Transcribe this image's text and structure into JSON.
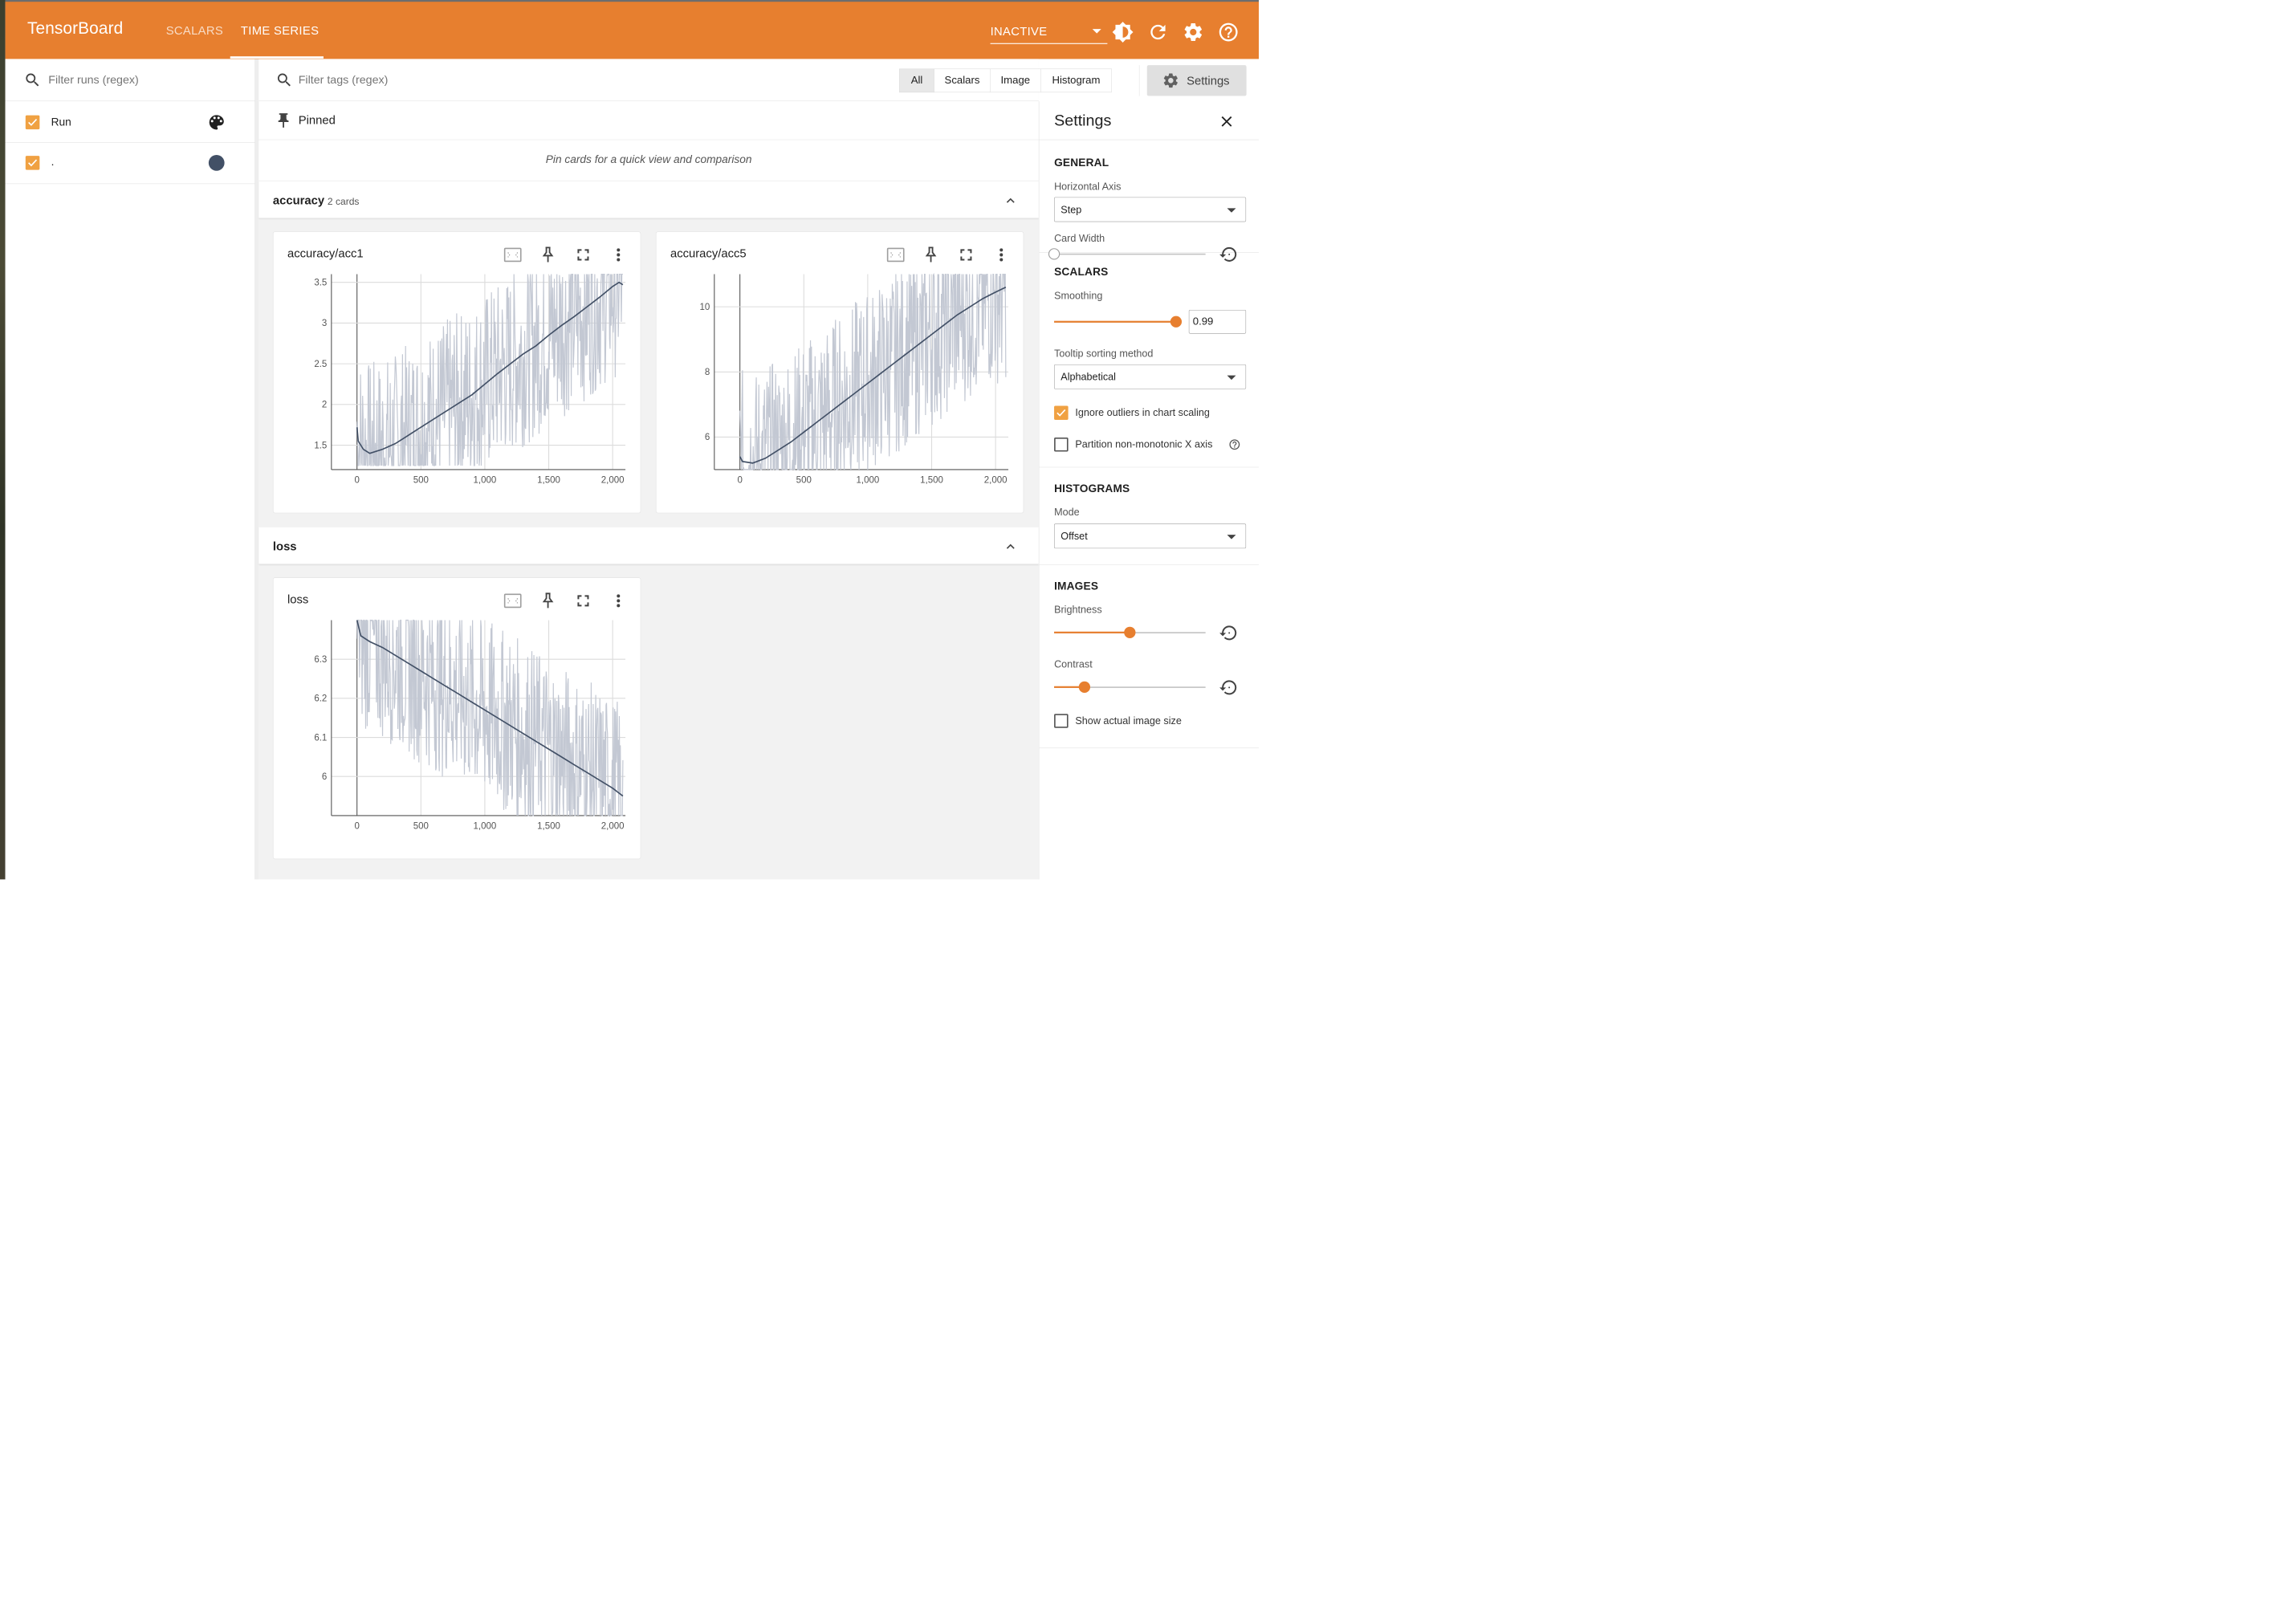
{
  "app": {
    "title": "TensorBoard",
    "nav_tabs": [
      {
        "label": "SCALARS",
        "active": false
      },
      {
        "label": "TIME SERIES",
        "active": true
      }
    ],
    "reload_status": "INACTIVE",
    "icons": [
      "brightness-icon",
      "refresh-icon",
      "gear-icon",
      "help-icon"
    ],
    "accent_color": "#e77f2f"
  },
  "runs_panel": {
    "filter_placeholder": "Filter runs (regex)",
    "header_label": "Run",
    "header_checked": true,
    "runs": [
      {
        "name": ".",
        "checked": true,
        "color": "#425066"
      }
    ]
  },
  "main": {
    "filter_placeholder": "Filter tags (regex)",
    "type_filters": [
      "All",
      "Scalars",
      "Image",
      "Histogram"
    ],
    "active_type_filter": "All",
    "settings_button": "Settings",
    "pinned": {
      "title": "Pinned",
      "empty_message": "Pin cards for a quick view and comparison"
    },
    "groups": [
      {
        "name": "accuracy",
        "count_label": "2 cards"
      },
      {
        "name": "loss",
        "count_label": ""
      }
    ]
  },
  "chart_data": [
    {
      "type": "line",
      "title": "accuracy/acc1",
      "xlim": [
        -200,
        2100
      ],
      "ylim": [
        1.2,
        3.6
      ],
      "x_ticks": [
        "0",
        "500",
        "1,000",
        "1,500",
        "2,000"
      ],
      "x_tick_values": [
        0,
        500,
        1000,
        1500,
        2000
      ],
      "y_ticks": [
        "1.5",
        "2",
        "2.5",
        "3",
        "3.5"
      ],
      "y_tick_values": [
        1.5,
        2,
        2.5,
        3,
        3.5
      ],
      "series": [
        {
          "role": "smoothed",
          "color": "#425066",
          "x": [
            0,
            10,
            50,
            100,
            200,
            300,
            400,
            500,
            600,
            700,
            800,
            900,
            1000,
            1100,
            1200,
            1300,
            1400,
            1500,
            1600,
            1700,
            1800,
            1900,
            2000,
            2050,
            2080
          ],
          "y": [
            1.72,
            1.55,
            1.45,
            1.4,
            1.45,
            1.52,
            1.62,
            1.72,
            1.82,
            1.92,
            2.02,
            2.12,
            2.25,
            2.38,
            2.5,
            2.62,
            2.72,
            2.85,
            2.97,
            3.08,
            3.2,
            3.32,
            3.45,
            3.5,
            3.47
          ]
        },
        {
          "role": "raw",
          "color": "#c3c8d3",
          "noise_lo": 1.25,
          "noise_hi": 3.6
        }
      ]
    },
    {
      "type": "line",
      "title": "accuracy/acc5",
      "xlim": [
        -200,
        2100
      ],
      "ylim": [
        5.0,
        11.0
      ],
      "x_ticks": [
        "0",
        "500",
        "1,000",
        "1,500",
        "2,000"
      ],
      "x_tick_values": [
        0,
        500,
        1000,
        1500,
        2000
      ],
      "y_ticks": [
        "6",
        "8",
        "10"
      ],
      "y_tick_values": [
        6,
        8,
        10
      ],
      "series": [
        {
          "role": "smoothed",
          "color": "#425066",
          "x": [
            0,
            20,
            100,
            200,
            300,
            400,
            500,
            600,
            700,
            800,
            900,
            1000,
            1100,
            1200,
            1300,
            1400,
            1500,
            1600,
            1700,
            1800,
            1900,
            2000,
            2080
          ],
          "y": [
            5.4,
            5.25,
            5.2,
            5.35,
            5.6,
            5.85,
            6.15,
            6.45,
            6.75,
            7.05,
            7.35,
            7.65,
            7.95,
            8.25,
            8.55,
            8.85,
            9.15,
            9.45,
            9.75,
            10.0,
            10.25,
            10.45,
            10.6
          ]
        },
        {
          "role": "raw",
          "color": "#c3c8d3",
          "noise_lo": 5.0,
          "noise_hi": 11.0
        }
      ]
    },
    {
      "type": "line",
      "title": "loss",
      "xlim": [
        -200,
        2100
      ],
      "ylim": [
        5.9,
        6.4
      ],
      "x_ticks": [
        "0",
        "500",
        "1,000",
        "1,500",
        "2,000"
      ],
      "x_tick_values": [
        0,
        500,
        1000,
        1500,
        2000
      ],
      "y_ticks": [
        "6",
        "6.1",
        "6.2",
        "6.3"
      ],
      "y_tick_values": [
        6.0,
        6.1,
        6.2,
        6.3
      ],
      "series": [
        {
          "role": "smoothed",
          "color": "#425066",
          "x": [
            0,
            30,
            100,
            200,
            300,
            400,
            500,
            600,
            700,
            800,
            900,
            1000,
            1100,
            1200,
            1300,
            1400,
            1500,
            1600,
            1700,
            1800,
            1900,
            2000,
            2080
          ],
          "y": [
            6.4,
            6.36,
            6.345,
            6.33,
            6.31,
            6.29,
            6.27,
            6.25,
            6.23,
            6.21,
            6.19,
            6.17,
            6.15,
            6.13,
            6.11,
            6.09,
            6.07,
            6.05,
            6.03,
            6.01,
            5.99,
            5.97,
            5.95
          ]
        },
        {
          "role": "raw",
          "color": "#c3c8d3",
          "noise_lo": 5.9,
          "noise_hi": 6.4
        }
      ]
    }
  ],
  "settings_panel": {
    "title": "Settings",
    "general": {
      "title": "GENERAL",
      "horizontal_axis_label": "Horizontal Axis",
      "horizontal_axis_value": "Step",
      "card_width_label": "Card Width",
      "card_width_value": 0
    },
    "scalars": {
      "title": "SCALARS",
      "smoothing_label": "Smoothing",
      "smoothing_value": "0.99",
      "smoothing_fraction": 0.99,
      "tooltip_label": "Tooltip sorting method",
      "tooltip_value": "Alphabetical",
      "ignore_outliers_label": "Ignore outliers in chart scaling",
      "ignore_outliers_checked": true,
      "partition_label": "Partition non-monotonic X axis",
      "partition_checked": false
    },
    "histograms": {
      "title": "HISTOGRAMS",
      "mode_label": "Mode",
      "mode_value": "Offset"
    },
    "images": {
      "title": "IMAGES",
      "brightness_label": "Brightness",
      "brightness_fraction": 0.5,
      "contrast_label": "Contrast",
      "contrast_fraction": 0.2,
      "actual_size_label": "Show actual image size",
      "actual_size_checked": false
    }
  }
}
